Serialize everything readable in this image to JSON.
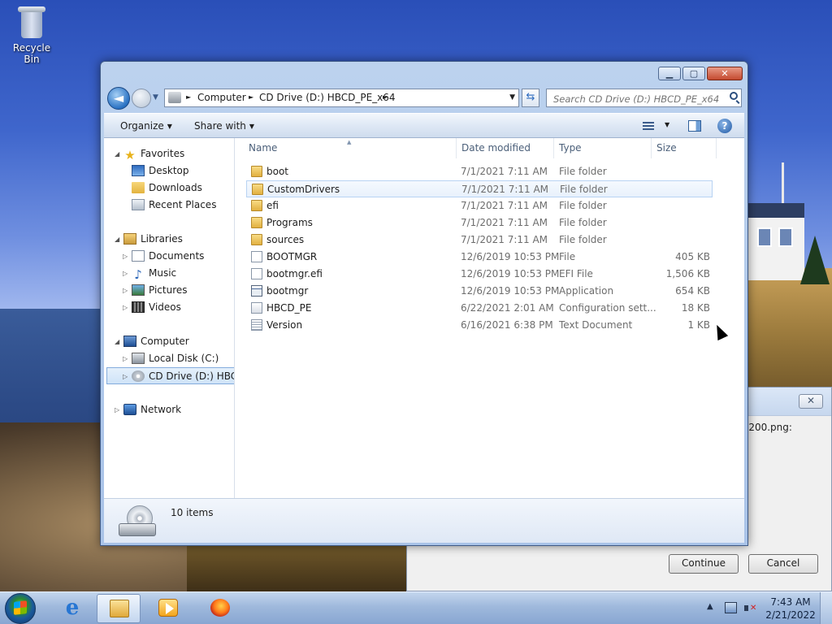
{
  "desktop": {
    "recycle_bin_label": "Recycle Bin"
  },
  "back_dialog": {
    "partial_text": "-200.png:",
    "close_symbol": "✕",
    "continue_label": "Continue",
    "cancel_label": "Cancel"
  },
  "window": {
    "controls": {
      "minimize": "▁",
      "maximize": "▢",
      "close": "✕"
    },
    "address": {
      "crumbs": [
        "Computer",
        "CD Drive (D:) HBCD_PE_x64"
      ]
    },
    "search": {
      "placeholder": "Search CD Drive (D:) HBCD_PE_x64"
    },
    "commands": {
      "organize": "Organize",
      "share_with": "Share with"
    },
    "help_symbol": "?",
    "nav": {
      "favorites": "Favorites",
      "desktop": "Desktop",
      "downloads": "Downloads",
      "recent_places": "Recent Places",
      "libraries": "Libraries",
      "documents": "Documents",
      "music": "Music",
      "pictures": "Pictures",
      "videos": "Videos",
      "computer": "Computer",
      "local_disk": "Local Disk (C:)",
      "cd_drive": "CD Drive (D:) HBCD_",
      "network": "Network"
    },
    "columns": {
      "name": "Name",
      "date_modified": "Date modified",
      "type": "Type",
      "size": "Size"
    },
    "files": [
      {
        "name": "boot",
        "date": "7/1/2021 7:11 AM",
        "type": "File folder",
        "size": "",
        "icon": "folder-icon"
      },
      {
        "name": "CustomDrivers",
        "date": "7/1/2021 7:11 AM",
        "type": "File folder",
        "size": "",
        "icon": "folder-icon"
      },
      {
        "name": "efi",
        "date": "7/1/2021 7:11 AM",
        "type": "File folder",
        "size": "",
        "icon": "folder-icon"
      },
      {
        "name": "Programs",
        "date": "7/1/2021 7:11 AM",
        "type": "File folder",
        "size": "",
        "icon": "folder-icon"
      },
      {
        "name": "sources",
        "date": "7/1/2021 7:11 AM",
        "type": "File folder",
        "size": "",
        "icon": "folder-icon"
      },
      {
        "name": "BOOTMGR",
        "date": "12/6/2019 10:53 PM",
        "type": "File",
        "size": "405 KB",
        "icon": "file-icon"
      },
      {
        "name": "bootmgr.efi",
        "date": "12/6/2019 10:53 PM",
        "type": "EFI File",
        "size": "1,506 KB",
        "icon": "file-icon"
      },
      {
        "name": "bootmgr",
        "date": "12/6/2019 10:53 PM",
        "type": "Application",
        "size": "654 KB",
        "icon": "application-icon"
      },
      {
        "name": "HBCD_PE",
        "date": "6/22/2021 2:01 AM",
        "type": "Configuration sett...",
        "size": "18 KB",
        "icon": "config-file-icon"
      },
      {
        "name": "Version",
        "date": "6/16/2021 6:38 PM",
        "type": "Text Document",
        "size": "1 KB",
        "icon": "text-document-icon"
      }
    ],
    "details": {
      "item_count": "10 items"
    }
  },
  "taskbar": {
    "ie_glyph": "e",
    "clock_time": "7:43 AM",
    "clock_date": "2/21/2022"
  }
}
